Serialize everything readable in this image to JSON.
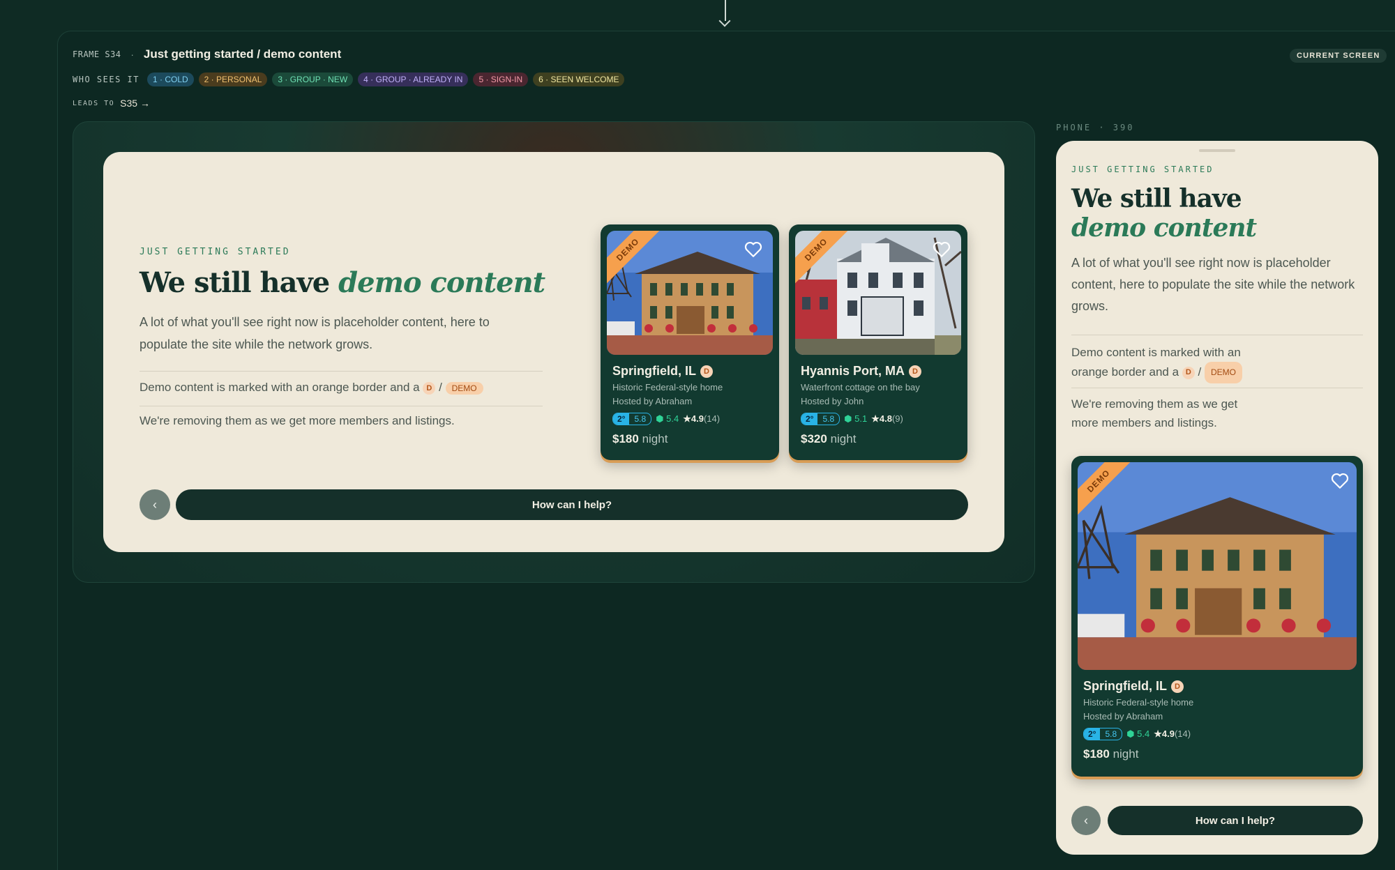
{
  "frame": {
    "id": "FRAME S34",
    "title": "Just getting started / demo content",
    "who_sees_label": "WHO SEES IT",
    "audiences": [
      {
        "label": "1 · COLD",
        "bg": "#1c4a5c",
        "fg": "#7fd0f0"
      },
      {
        "label": "2 · PERSONAL",
        "bg": "#4a3c1e",
        "fg": "#f0c070"
      },
      {
        "label": "3 · GROUP · NEW",
        "bg": "#1b4a3a",
        "fg": "#6fe0b4"
      },
      {
        "label": "4 · GROUP · ALREADY IN",
        "bg": "#362f5a",
        "fg": "#c0b0f8"
      },
      {
        "label": "5 · SIGN-IN",
        "bg": "#4a2630",
        "fg": "#f49aa8"
      },
      {
        "label": "6 · SEEN WELCOME",
        "bg": "#3e4020",
        "fg": "#f0e6a0"
      }
    ],
    "leads_to_label": "LEADS TO",
    "leads_to": "S35 →",
    "current_screen": "CURRENT SCREEN",
    "phone_label": "PHONE · 390"
  },
  "content": {
    "eyebrow": "JUST GETTING STARTED",
    "headline_plain": "We still have",
    "headline_em": "demo content",
    "intro": "A lot of what you'll see right now is placeholder content, here to populate the site while the network grows.",
    "marked_text": "Demo content is marked with an orange border and a",
    "marked_text_phone_1": "Demo content is marked with an",
    "marked_text_phone_2": "orange border and a",
    "chip_d": "D",
    "slash": "/",
    "chip_demo": "DEMO",
    "removing_text": "We're removing them as we get more members and listings.",
    "removing_text_phone_1": "We're removing them as we get",
    "removing_text_phone_2": "more members and listings.",
    "back_icon": "‹",
    "help_button": "How can I help?"
  },
  "listings": [
    {
      "ribbon": "DEMO",
      "city": "Springfield, IL",
      "badge": "D",
      "desc": "Historic Federal-style home",
      "host": "Hosted by Abraham",
      "deg": "2°",
      "score": "5.8",
      "shield": "⬢ 5.4",
      "rating": "★4.9",
      "reviews": "(14)",
      "price": "$180",
      "price_unit": "night"
    },
    {
      "ribbon": "DEMO",
      "city": "Hyannis Port, MA",
      "badge": "D",
      "desc": "Waterfront cottage on the bay",
      "host": "Hosted by John",
      "deg": "2°",
      "score": "5.8",
      "shield": "⬢ 5.1",
      "rating": "★4.8",
      "reviews": "(9)",
      "price": "$320",
      "price_unit": "night"
    }
  ],
  "colors": {
    "page_bg": "#0f2b24",
    "cream": "#efe9da",
    "dark_green": "#15302a",
    "accent_green": "#2b7a58",
    "demo_orange": "#f6a04d"
  }
}
